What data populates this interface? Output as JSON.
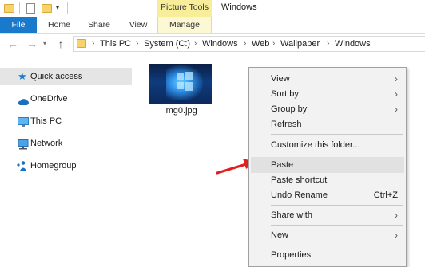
{
  "titlebar": {
    "contextual_group": "Picture Tools",
    "window_title": "Windows"
  },
  "tabs": [
    "File",
    "Home",
    "Share",
    "View",
    "Manage"
  ],
  "address": {
    "crumbs": [
      "This PC",
      "System (C:)",
      "Windows",
      "Web",
      "Wallpaper",
      "Windows"
    ]
  },
  "nav": {
    "items": [
      {
        "label": "Quick access",
        "icon": "star-icon"
      },
      {
        "label": "OneDrive",
        "icon": "cloud-icon"
      },
      {
        "label": "This PC",
        "icon": "monitor-icon"
      },
      {
        "label": "Network",
        "icon": "network-icon"
      },
      {
        "label": "Homegroup",
        "icon": "homegroup-icon"
      }
    ]
  },
  "file": {
    "name": "img0.jpg"
  },
  "context_menu": {
    "items": [
      {
        "label": "View",
        "submenu": true
      },
      {
        "label": "Sort by",
        "submenu": true
      },
      {
        "label": "Group by",
        "submenu": true
      },
      {
        "label": "Refresh"
      },
      {
        "label": "Customize this folder..."
      },
      {
        "label": "Paste",
        "highlighted": true
      },
      {
        "label": "Paste shortcut"
      },
      {
        "label": "Undo Rename",
        "shortcut": "Ctrl+Z"
      },
      {
        "label": "Share with",
        "submenu": true
      },
      {
        "label": "New",
        "submenu": true
      },
      {
        "label": "Properties"
      }
    ]
  },
  "colors": {
    "file_tab": "#1979ca",
    "contextual_tab": "#f8ee9a",
    "selection": "#e5e5e5",
    "arrow": "#e02020"
  }
}
